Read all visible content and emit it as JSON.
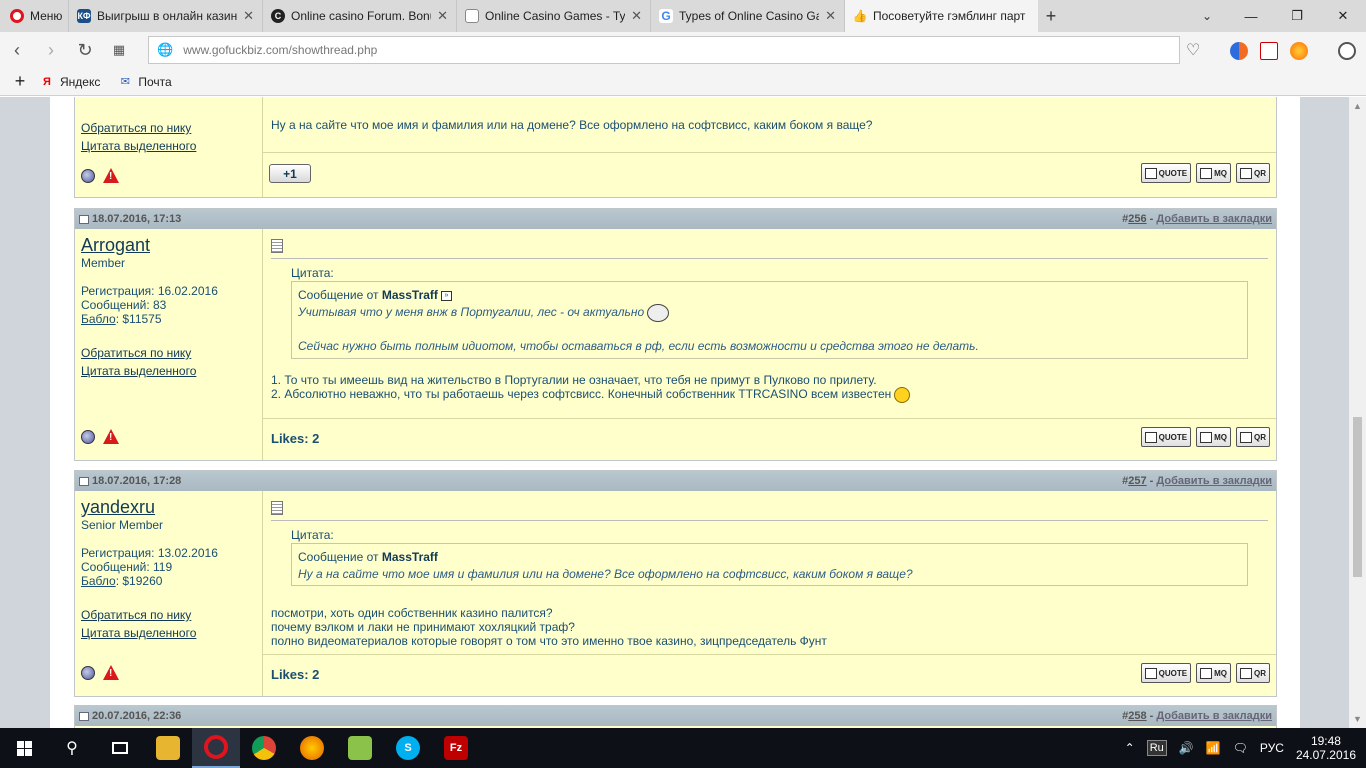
{
  "browser": {
    "menu_label": "Меню",
    "tabs": [
      {
        "title": "Выигрыш в онлайн казино f",
        "fav": "КФ",
        "color": "#1a4f8a"
      },
      {
        "title": "Online casino Forum. Bonuse",
        "fav": "C",
        "color": "#222222"
      },
      {
        "title": "Online Casino Games - Types",
        "fav": "",
        "color": "#888888"
      },
      {
        "title": "Types of Online Casino Game",
        "fav": "G",
        "color": "#4285f4"
      },
      {
        "title": "Посоветуйте гэмблинг парт",
        "fav": "👍",
        "color": "#e8a200"
      }
    ],
    "url": "www.gofuckbiz.com/showthread.php",
    "bookmarks": [
      {
        "label": "Яндекс",
        "icon": "Я"
      },
      {
        "label": "Почта",
        "icon": "✉"
      }
    ]
  },
  "top_post": {
    "link_nick": "Обратиться по нику",
    "link_quote": "Цитата выделенного",
    "message": "Ну а на сайте что мое имя и фамилия или на домене? Все оформлено на софтсвисс, каким боком я ваще?",
    "plus_one": "+1"
  },
  "posts": [
    {
      "date": "18.07.2016, 17:13",
      "hash": "#",
      "number": "256",
      "bookmark": "Добавить в закладки",
      "username": "Arrogant",
      "user_title": "Member",
      "reg": "Регистрация: 16.02.2016",
      "msgs": "Сообщений: 83",
      "bablo_label": "Бабло",
      "bablo_value": ": $11575",
      "link_nick": "Обратиться по нику",
      "link_quote": "Цитата выделенного",
      "quote_label": "Цитата:",
      "quote_from": "Сообщение от",
      "quote_author": "MassTraff",
      "quote_line1": "Учитывая что у меня внж в Португалии, лес - оч актуально",
      "quote_line2": "Сейчас нужно быть полным идиотом, чтобы оставаться в рф, если есть возможности и средства этого не делать.",
      "body1": "1. То что ты имеешь вид на жительство в Португалии не означает, что тебя не примут в Пулково по прилету.",
      "body2": "2. Абсолютно неважно, что ты работаешь через софтсвисс. Конечный собственник TTRCASINO всем известен",
      "likes": "Likes: 2"
    },
    {
      "date": "18.07.2016, 17:28",
      "hash": "#",
      "number": "257",
      "bookmark": "Добавить в закладки",
      "username": "yandexru",
      "user_title": "Senior Member",
      "reg": "Регистрация: 13.02.2016",
      "msgs": "Сообщений: 119",
      "bablo_label": "Бабло",
      "bablo_value": ": $19260",
      "link_nick": "Обратиться по нику",
      "link_quote": "Цитата выделенного",
      "quote_label": "Цитата:",
      "quote_from": "Сообщение от",
      "quote_author": "MassTraff",
      "quote_line1": "Ну а на сайте что мое имя и фамилия или на домене? Все оформлено на софтсвисс, каким боком я ваще?",
      "body1": "посмотри, хоть один собственник казино палится?",
      "body2": "почему вэлком и лаки не принимают хохляцкий траф?",
      "body3": "полно видеоматериалов которые говорят о том что это именно твое казино, зицпредседатель Фунт",
      "likes": "Likes: 2"
    },
    {
      "date": "20.07.2016, 22:36",
      "hash": "#",
      "number": "258",
      "bookmark": "Добавить в закладки"
    }
  ],
  "buttons": {
    "quote": "QUOTE",
    "mq": "MQ",
    "qr": "QR"
  },
  "taskbar": {
    "lang_box": "Ru",
    "lang": "РУС",
    "time": "19:48",
    "date": "24.07.2016"
  }
}
